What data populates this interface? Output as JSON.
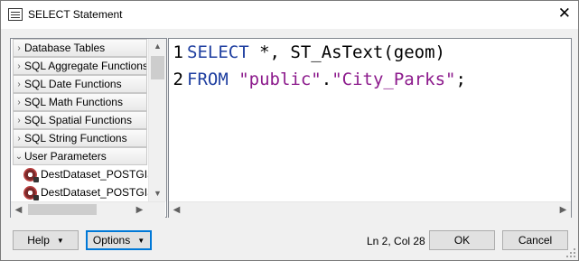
{
  "window": {
    "title": "SELECT Statement"
  },
  "tree": {
    "categories": [
      {
        "label": "Database Tables",
        "expanded": false
      },
      {
        "label": "SQL Aggregate Functions",
        "expanded": false
      },
      {
        "label": "SQL Date Functions",
        "expanded": false
      },
      {
        "label": "SQL Math Functions",
        "expanded": false
      },
      {
        "label": "SQL Spatial Functions",
        "expanded": false
      },
      {
        "label": "SQL String Functions",
        "expanded": false
      },
      {
        "label": "User Parameters",
        "expanded": true
      }
    ],
    "parameters": [
      {
        "label": "DestDataset_POSTGIS"
      },
      {
        "label": "DestDataset_POSTGIS"
      }
    ]
  },
  "editor": {
    "lines": [
      {
        "num": "1",
        "tokens": [
          {
            "t": "SELECT",
            "c": "kw"
          },
          {
            "t": " *, ST_AsText(geom)",
            "c": ""
          }
        ]
      },
      {
        "num": "2",
        "tokens": [
          {
            "t": "FROM",
            "c": "kw"
          },
          {
            "t": " ",
            "c": ""
          },
          {
            "t": "\"public\"",
            "c": "str"
          },
          {
            "t": ".",
            "c": ""
          },
          {
            "t": "\"City_Parks\"",
            "c": "str"
          },
          {
            "t": ";",
            "c": ""
          }
        ]
      }
    ]
  },
  "footer": {
    "help_label": "Help",
    "options_label": "Options",
    "status": "Ln 2, Col 28",
    "ok_label": "OK",
    "cancel_label": "Cancel"
  },
  "colors": {
    "keyword": "#1f3fa0",
    "string": "#8c1a8c",
    "focus": "#0078d7"
  }
}
